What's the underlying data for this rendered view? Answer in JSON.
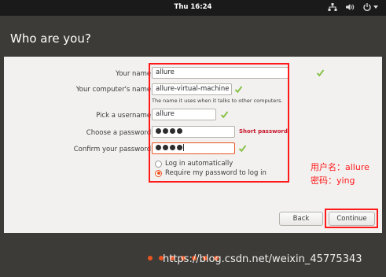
{
  "topbar": {
    "clock": "Thu 16:24",
    "icons": [
      "network-icon",
      "volume-icon",
      "power-icon"
    ]
  },
  "header": {
    "title": "Who are you?"
  },
  "form": {
    "name_label": "Your name:",
    "name_value": "allure",
    "computer_label": "Your computer's name:",
    "computer_value": "allure-virtual-machine",
    "computer_hint": "The name it uses when it talks to other computers.",
    "username_label": "Pick a username:",
    "username_value": "allure",
    "password_label": "Choose a password:",
    "password_strength": "Short password",
    "confirm_label": "Confirm your password:",
    "login_auto": "Log in automatically",
    "login_require": "Require my password to log in",
    "selected_login": "require"
  },
  "annotation": {
    "user_line": "用户名：allure",
    "pass_line": "密码：ying"
  },
  "buttons": {
    "back": "Back",
    "continue": "Continue"
  },
  "footer": {
    "watermark": "https://blog.csdn.net/weixin_45775343",
    "progress_steps": 7
  },
  "colors": {
    "accent": "#e95420",
    "check": "#8ac24a",
    "annotation": "#ff1a1a",
    "warning": "#c7162b"
  }
}
